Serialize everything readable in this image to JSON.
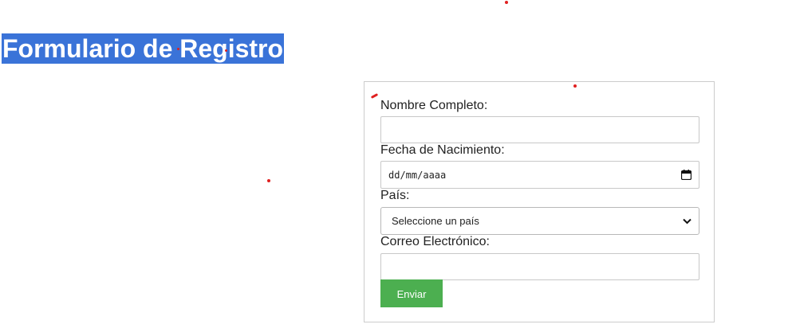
{
  "page": {
    "title": "Formulario de Registro"
  },
  "form": {
    "name_label": "Nombre Completo:",
    "name_value": "",
    "birthdate_label": "Fecha de Nacimiento:",
    "birthdate_placeholder": "dd/mm/aaaa",
    "country_label": "País:",
    "country_selected": "Seleccione un país",
    "email_label": "Correo Electrónico:",
    "email_value": "",
    "submit_label": "Enviar"
  },
  "icons": {
    "date_picker": "calendar-icon",
    "select_arrow": "chevron-down-icon"
  },
  "colors": {
    "title_highlight": "#3a73d8",
    "submit_button": "#4caf50",
    "annotation_marks": "#e02020"
  }
}
